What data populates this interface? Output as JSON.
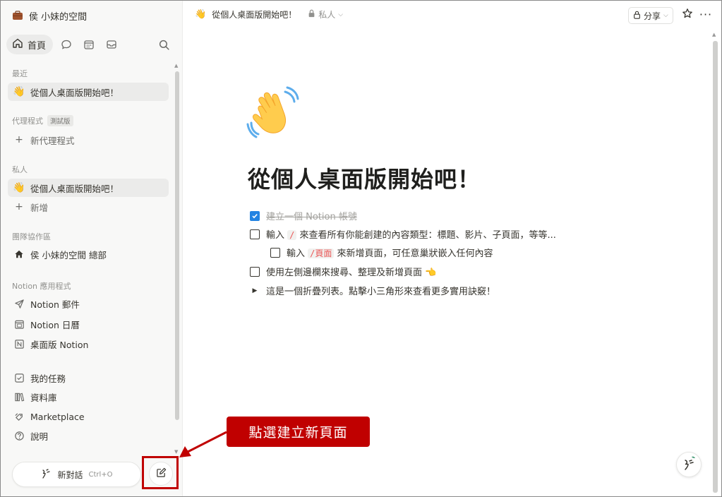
{
  "workspace": {
    "name": "侯 小妹的空間",
    "icon": "briefcase-icon"
  },
  "nav": {
    "home_label": "首頁"
  },
  "sidebar": {
    "recent_label": "最近",
    "recent_items": [
      {
        "label": "從個人桌面版開始吧！",
        "icon": "waving-hand-icon"
      }
    ],
    "agents_label": "代理程式",
    "agents_badge": "測試版",
    "new_agent_label": "新代理程式",
    "private_label": "私人",
    "private_items": [
      {
        "label": "從個人桌面版開始吧！",
        "icon": "waving-hand-icon"
      }
    ],
    "add_new_label": "新增",
    "teamspace_label": "團隊協作區",
    "teamspace_item": "侯 小妹的空間 總部",
    "apps_label": "Notion 應用程式",
    "apps": [
      {
        "label": "Notion 郵件",
        "icon": "mail-send-icon"
      },
      {
        "label": "Notion 日曆",
        "icon": "calendar-icon"
      },
      {
        "label": "桌面版 Notion",
        "icon": "notion-app-icon"
      }
    ],
    "bottom_items": [
      {
        "label": "我的任務",
        "icon": "task-check-icon"
      },
      {
        "label": "資料庫",
        "icon": "library-icon"
      },
      {
        "label": "Marketplace",
        "icon": "marketplace-icon"
      },
      {
        "label": "說明",
        "icon": "help-icon"
      }
    ],
    "new_chat_label": "新對話",
    "new_chat_shortcut": "Ctrl+O"
  },
  "topbar": {
    "page_title": "從個人桌面版開始吧！",
    "privacy_label": "私人",
    "share_label": "分享"
  },
  "page": {
    "title": "從個人桌面版開始吧！",
    "todos": [
      {
        "text": "建立一個 Notion 帳號",
        "checked": true
      },
      {
        "pre": "輸入",
        "code": "/",
        "post": "來查看所有你能創建的內容類型：標題、影片、子頁面，等等...",
        "checked": false
      },
      {
        "pre": "輸入",
        "code": "/頁面",
        "post": "來新增頁面，可任意巢狀嵌入任何內容",
        "checked": false
      },
      {
        "pre": "使用左側邊欄來搜尋、整理及新增頁面",
        "emoji": "👈",
        "checked": false
      }
    ],
    "toggle": "這是一個折疊列表。點擊小三角形來查看更多實用訣竅！"
  },
  "annotation": {
    "callout_text": "點選建立新頁面"
  },
  "colors": {
    "accent_red": "#c00000",
    "checkbox_blue": "#2383e2"
  }
}
